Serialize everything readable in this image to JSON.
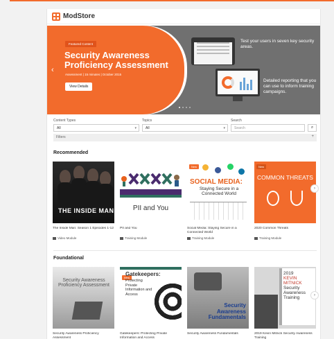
{
  "app": {
    "brand": "ModStore"
  },
  "hero": {
    "badge": "Featured Content",
    "title": "Security Awareness Proficiency Assessment",
    "meta": "Assessment | 15 minutes | October 2015",
    "button": "View Details",
    "text1": "Test your users in seven key security areas.",
    "text2": "Detailed reporting that you can use to inform training campaigns."
  },
  "filters": {
    "content_types_label": "Content Types",
    "content_types_value": "All",
    "topics_label": "Topics",
    "topics_value": "All",
    "search_label": "Search",
    "search_placeholder": "Search",
    "filters_label": "Filters"
  },
  "recommended": {
    "title": "Recommended",
    "cards": [
      {
        "title": "The Inside Man: Season 1 Episodes 1-12",
        "type": "Video Module",
        "thumb_text": "THE INSIDE MAN"
      },
      {
        "title": "PII and You",
        "type": "Training Module",
        "thumb_text": "PII and You"
      },
      {
        "title": "Social Media: Staying Secure in a Connected World",
        "type": "Training Module",
        "thumb_head": "SOCIAL MEDIA:",
        "thumb_sub": "Staying Secure in a Connected World",
        "new": "New"
      },
      {
        "title": "2020 Common Threats",
        "type": "Training Module",
        "thumb_text": "COMMON THREATS",
        "new": "New"
      }
    ]
  },
  "foundational": {
    "title": "Foundational",
    "cards": [
      {
        "title": "Security Awareness Proficiency Assessment",
        "thumb_text": "Security Awareness Proficiency Assessment"
      },
      {
        "title": "Gatekeepers: Protecting Private Information and Access",
        "thumb_title": "Gatekeepers:",
        "thumb_sub": "Protecting Private Information and Access",
        "new": "New"
      },
      {
        "title": "Security Awareness Fundamentals",
        "thumb_text": "Security Awareness Fundamentals"
      },
      {
        "title": "2019 Kevin Mitnick Security Awareness Training",
        "thumb_year": "2019",
        "thumb_name": "KEVIN MITNICK",
        "thumb_text": "Security Awareness Training"
      }
    ]
  },
  "colors": {
    "accent": "#f26b2c",
    "hero_gray": "#707070"
  }
}
